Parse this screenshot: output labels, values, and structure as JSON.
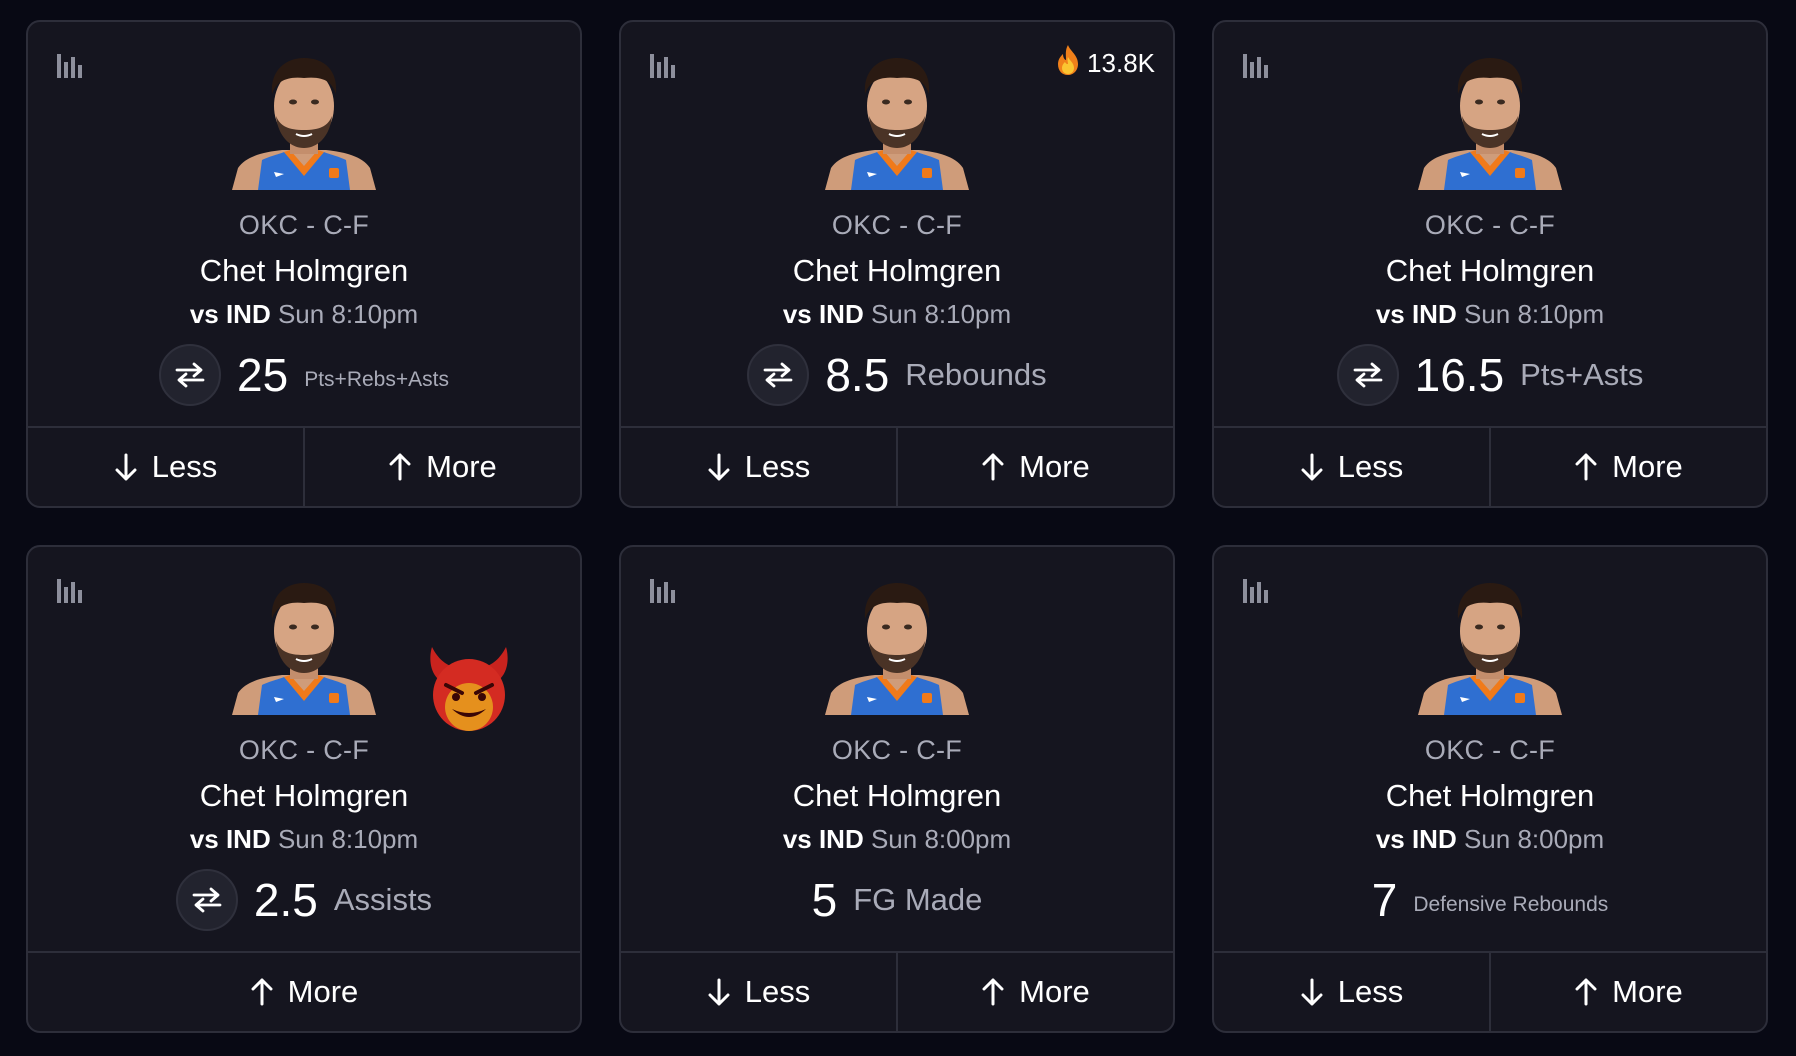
{
  "colors": {
    "background": "#080914",
    "card": "#15151f",
    "border": "#2d2e3a",
    "text_primary": "#ffffff",
    "text_secondary": "#a9abb8"
  },
  "icons": {
    "stats": "bar-chart-icon",
    "swap": "swap-arrows-icon",
    "trending": "fire-icon",
    "demon": "demon-emoji-icon",
    "less": "arrow-down-icon",
    "more": "arrow-up-icon"
  },
  "cards": [
    {
      "team_pos": "OKC - C-F",
      "player": "Chet Holmgren",
      "opp": "vs IND",
      "time": "Sun 8:10pm",
      "line": "25",
      "stat": "Pts+Rebs+Asts",
      "stat_size": "small",
      "swap": true,
      "trending": "",
      "demon": false,
      "less_label": "Less",
      "more_label": "More",
      "show_less": true
    },
    {
      "team_pos": "OKC - C-F",
      "player": "Chet Holmgren",
      "opp": "vs IND",
      "time": "Sun 8:10pm",
      "line": "8.5",
      "stat": "Rebounds",
      "stat_size": "big",
      "swap": true,
      "trending": "13.8K",
      "demon": false,
      "less_label": "Less",
      "more_label": "More",
      "show_less": true
    },
    {
      "team_pos": "OKC - C-F",
      "player": "Chet Holmgren",
      "opp": "vs IND",
      "time": "Sun 8:10pm",
      "line": "16.5",
      "stat": "Pts+Asts",
      "stat_size": "big",
      "swap": true,
      "trending": "",
      "demon": false,
      "less_label": "Less",
      "more_label": "More",
      "show_less": true
    },
    {
      "team_pos": "OKC - C-F",
      "player": "Chet Holmgren",
      "opp": "vs IND",
      "time": "Sun 8:10pm",
      "line": "2.5",
      "stat": "Assists",
      "stat_size": "big",
      "swap": true,
      "trending": "",
      "demon": true,
      "less_label": "",
      "more_label": "More",
      "show_less": false
    },
    {
      "team_pos": "OKC - C-F",
      "player": "Chet Holmgren",
      "opp": "vs IND",
      "time": "Sun 8:00pm",
      "line": "5",
      "stat": "FG Made",
      "stat_size": "big",
      "swap": false,
      "trending": "",
      "demon": false,
      "less_label": "Less",
      "more_label": "More",
      "show_less": true
    },
    {
      "team_pos": "OKC - C-F",
      "player": "Chet Holmgren",
      "opp": "vs IND",
      "time": "Sun 8:00pm",
      "line": "7",
      "stat": "Defensive Rebounds",
      "stat_size": "small",
      "swap": false,
      "trending": "",
      "demon": false,
      "less_label": "Less",
      "more_label": "More",
      "show_less": true
    }
  ]
}
